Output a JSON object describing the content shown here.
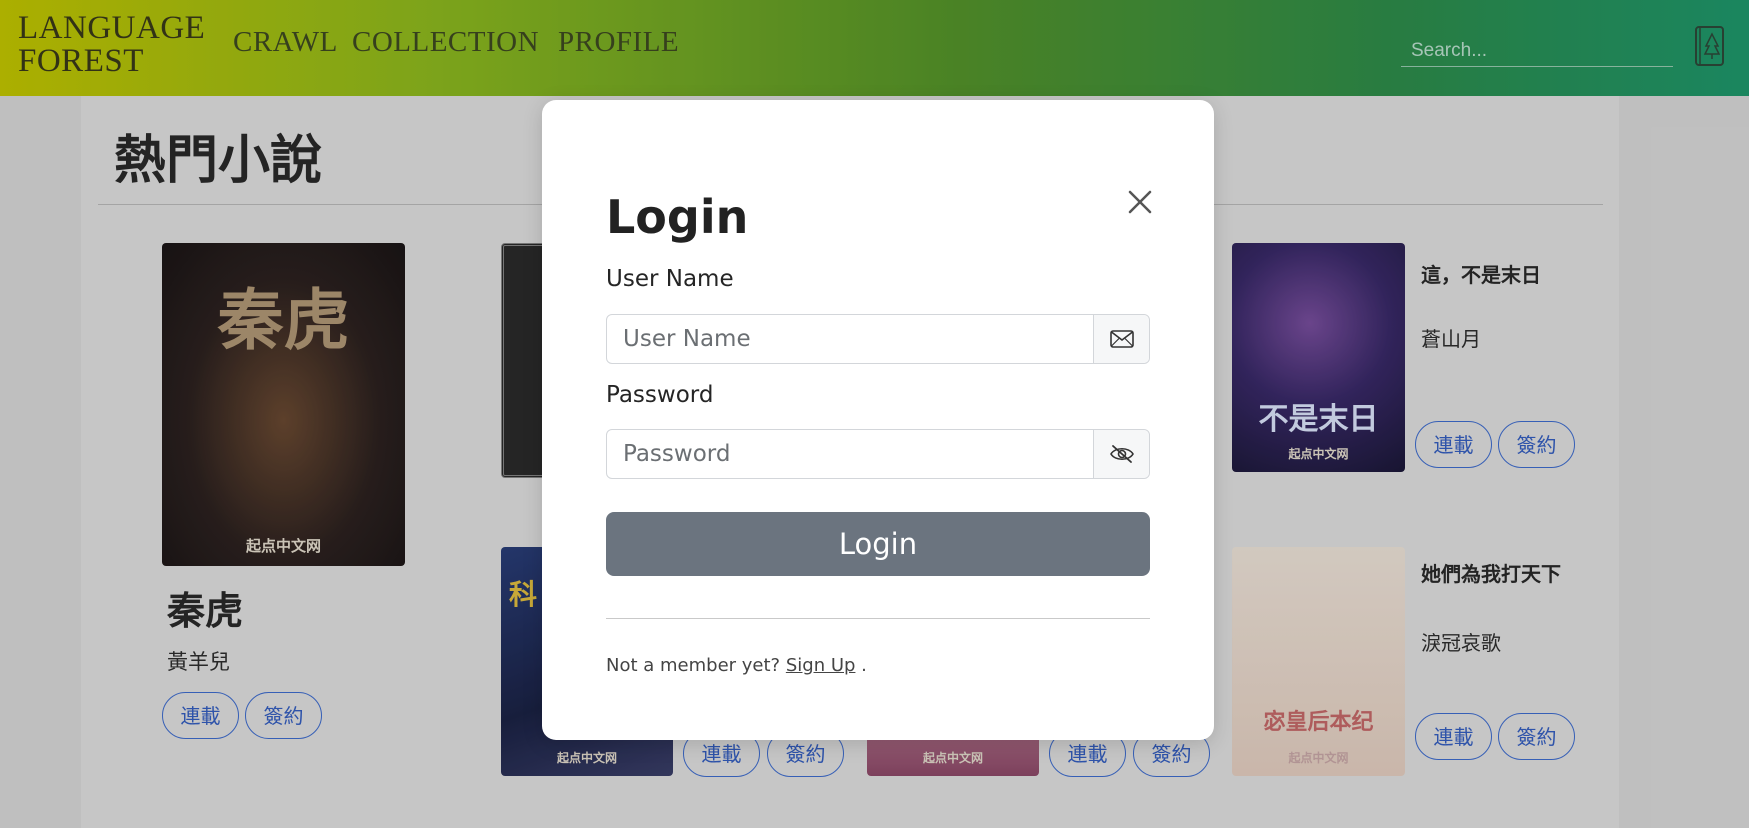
{
  "header": {
    "brand_line1": "LANGUAGE",
    "brand_line2": "FOREST",
    "nav": [
      "CRAWL",
      "COLLECTION",
      "PROFILE"
    ],
    "search_placeholder": "Search...",
    "brand_color": "#55962b"
  },
  "page": {
    "section_title": "熱門小說",
    "books": [
      {
        "title": "秦虎",
        "author": "黃羊兒",
        "cover_text": "秦虎",
        "cover_caption": "起点中文网",
        "tags": [
          "連載",
          "簽約"
        ]
      },
      {
        "title": "這，不是末日",
        "author": "蒼山月",
        "cover_text": "不是末日",
        "cover_caption": "起点中文网",
        "tags": [
          "連載",
          "簽約"
        ]
      },
      {
        "title": "她們為我打天下",
        "author": "淚冠哀歌",
        "cover_text": "宓皇后本纪",
        "cover_caption": "起点中文网",
        "tags": [
          "連載",
          "簽約"
        ]
      },
      {
        "cover_text": "科",
        "cover_caption": "起点中文网"
      },
      {
        "cover_caption": "起点中文网"
      }
    ],
    "partial_tags": [
      "連載",
      "簽約",
      "連載",
      "簽約"
    ]
  },
  "modal": {
    "title": "Login",
    "username_label": "User Name",
    "username_placeholder": "User Name",
    "password_label": "Password",
    "password_placeholder": "Password",
    "submit_label": "Login",
    "signup_prefix": "Not a member yet? ",
    "signup_link": "Sign Up",
    "signup_suffix": " ."
  }
}
